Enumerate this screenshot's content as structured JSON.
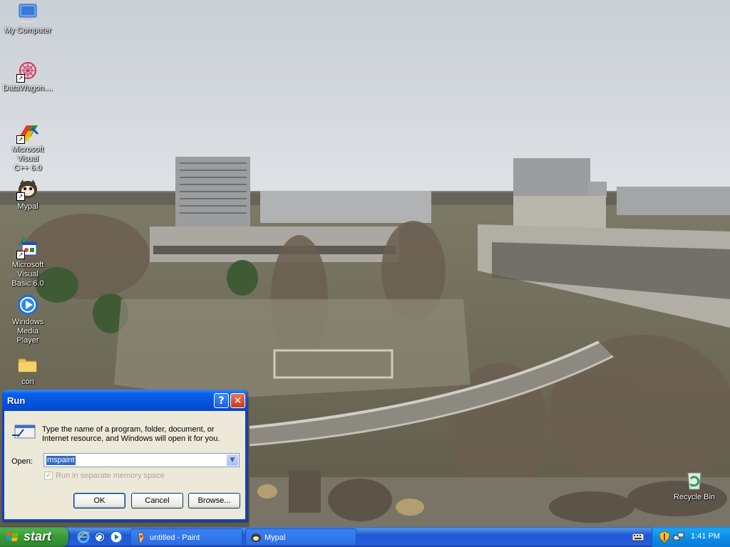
{
  "desktop": {
    "icons": [
      {
        "label": "My Computer",
        "icon": "my-computer-icon"
      },
      {
        "label": "DataWagon....",
        "icon": "datawagon-icon"
      },
      {
        "label": "Microsoft Visual\nC++ 6.0",
        "icon": "visual-cpp-icon"
      },
      {
        "label": "Mypal",
        "icon": "mypal-icon"
      },
      {
        "label": "Microsoft Visual\nBasic 6.0",
        "icon": "visual-basic-icon"
      },
      {
        "label": "Windows Media\nPlayer",
        "icon": "media-player-icon"
      },
      {
        "label": "con",
        "icon": "folder-icon"
      },
      {
        "label": "Recycle Bin",
        "icon": "recycle-bin-icon"
      }
    ]
  },
  "run_dialog": {
    "title": "Run",
    "description": "Type the name of a program, folder, document, or Internet resource, and Windows will open it for you.",
    "open_label": "Open:",
    "open_value": "mspaint",
    "checkbox_label": "Run in separate memory space",
    "checkbox_checked": true,
    "checkbox_enabled": false,
    "ok_label": "OK",
    "cancel_label": "Cancel",
    "browse_label": "Browse..."
  },
  "taskbar": {
    "start_label": "start",
    "quick_launch": [
      "internet-explorer-icon",
      "show-desktop-icon",
      "media-player-icon"
    ],
    "tasks": [
      {
        "label": "untitled - Paint",
        "icon": "paint-icon"
      },
      {
        "label": "Mypal",
        "icon": "mypal-icon"
      }
    ],
    "tray_icons": [
      "keyboard-icon",
      "security-shield-icon",
      "network-icon"
    ],
    "clock": "1:41 PM"
  },
  "colors": {
    "taskbar_blue": "#245edb",
    "start_green": "#3c9a3c",
    "tray_blue": "#0e8ce8",
    "dialog_face": "#ece9d8",
    "title_blue": "#0553e0"
  }
}
